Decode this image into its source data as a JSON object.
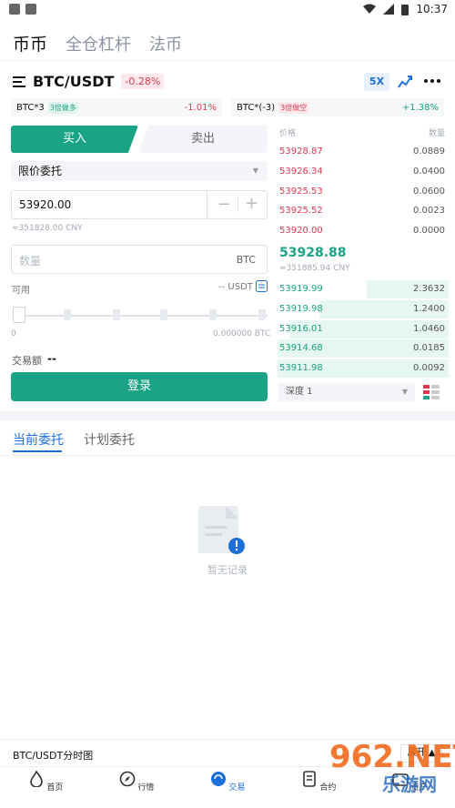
{
  "status_bar": {
    "time": "10:37"
  },
  "top_tabs": [
    "币币",
    "全仓杠杆",
    "法币"
  ],
  "pair": {
    "name": "BTC/USDT",
    "change": "-0.28%",
    "leverage": "5X"
  },
  "lev_tokens": [
    {
      "name": "BTC*3",
      "tag": "3倍做多",
      "change": "-1.01%"
    },
    {
      "name": "BTC*(-3)",
      "tag": "3倍做空",
      "change": "+1.38%"
    }
  ],
  "trade": {
    "buy": "买入",
    "sell": "卖出",
    "order_type": "限价委托",
    "price": "53920.00",
    "price_cny": "≈351828.00 CNY",
    "amount_placeholder": "数量",
    "amount_unit": "BTC",
    "available_label": "可用",
    "available_value": "-- USDT",
    "slider_min": "0",
    "slider_max": "0.000000 BTC",
    "volume_label": "交易额",
    "volume_value": "--",
    "login": "登录"
  },
  "orderbook": {
    "price_header": "价格",
    "qty_header": "数量",
    "asks": [
      {
        "price": "53928.87",
        "qty": "0.0889"
      },
      {
        "price": "53926.34",
        "qty": "0.0400"
      },
      {
        "price": "53925.53",
        "qty": "0.0600"
      },
      {
        "price": "53925.52",
        "qty": "0.0023"
      },
      {
        "price": "53920.00",
        "qty": "0.0000"
      }
    ],
    "last_price": "53928.88",
    "last_cny": "≈351885.94 CNY",
    "bids": [
      {
        "price": "53919.99",
        "qty": "2.3632"
      },
      {
        "price": "53919.98",
        "qty": "1.2400"
      },
      {
        "price": "53916.01",
        "qty": "1.0460"
      },
      {
        "price": "53914.68",
        "qty": "0.0185"
      },
      {
        "price": "53911.98",
        "qty": "0.0092"
      }
    ],
    "depth": "深度 1"
  },
  "order_tabs": [
    "当前委托",
    "计划委托"
  ],
  "empty_text": "暂无记录",
  "chart_bar": {
    "title": "BTC/USDT分时图",
    "expand": "展开"
  },
  "bottom_nav": [
    "首页",
    "行情",
    "交易",
    "合约",
    "资产"
  ],
  "watermark": {
    "top": "962.NET",
    "bottom": "乐游网"
  },
  "colors": {
    "green": "#1aa384",
    "red": "#e0394f",
    "blue": "#1e6fd9"
  }
}
